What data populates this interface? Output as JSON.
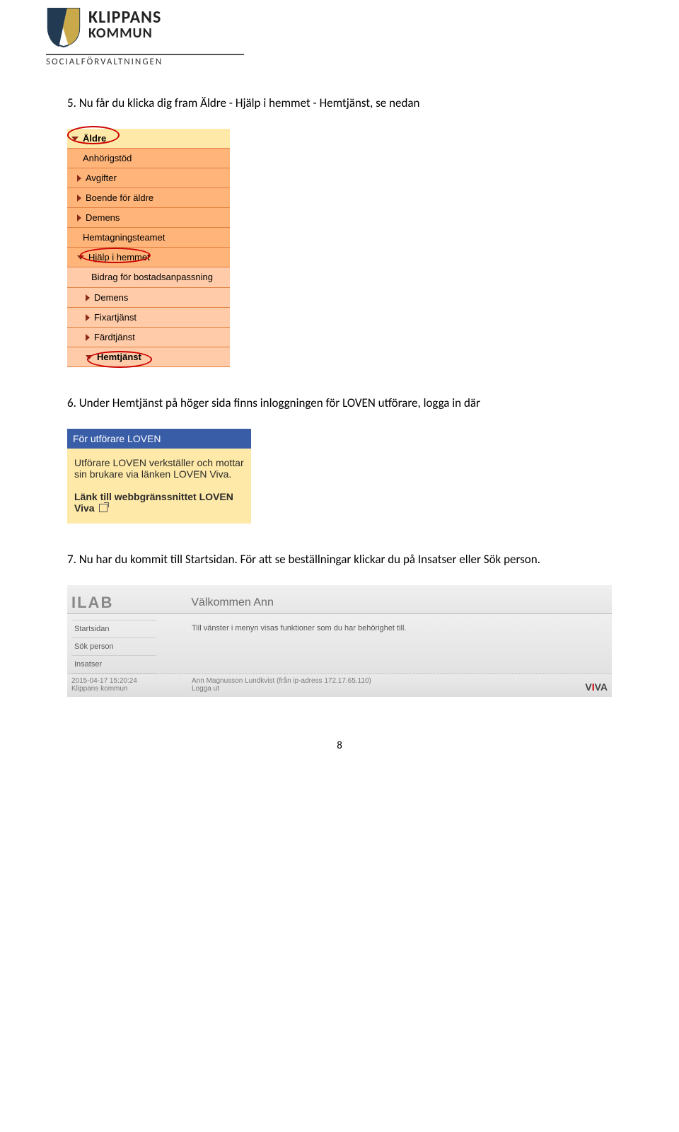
{
  "logo": {
    "line1": "KLIPPANS",
    "line2": "KOMMUN",
    "sub": "SOCIALFÖRVALTNINGEN"
  },
  "steps": {
    "s5": "5. Nu får du klicka dig fram Äldre - Hjälp i hemmet - Hemtjänst, se nedan",
    "s6": "6. Under Hemtjänst på höger sida finns inloggningen för LOVEN utförare, logga in där",
    "s7": "7. Nu har du kommit till Startsidan. För att se beställningar klickar du på Insatser eller Sök person."
  },
  "nav": {
    "aldre": "Äldre",
    "items1": [
      "Anhörigstöd",
      "Avgifter",
      "Boende för äldre",
      "Demens",
      "Hemtagningsteamet"
    ],
    "hjalp": "Hjälp i hemmet",
    "items2_first": "Bidrag för bostadsanpassning",
    "items2": [
      "Demens",
      "Fixartjänst",
      "Färdtjänst"
    ],
    "hemtjanst": "Hemtjänst"
  },
  "loven": {
    "title": "För utförare LOVEN",
    "body": "Utförare LOVEN verkställer och mottar sin brukare via länken LOVEN Viva.",
    "linktitle": "Länk till webbgränssnittet LOVEN Viva"
  },
  "app": {
    "brand": "ILAB",
    "welcome": "Välkommen Ann",
    "subtext": "Till vänster i menyn visas funktioner som du har behörighet till.",
    "menu": [
      "Startsidan",
      "Sök person",
      "Insatser"
    ],
    "footer": {
      "ts": "2015-04-17 15:20:24",
      "org": "Klippans kommun",
      "user": "Ann Magnusson Lundkvist (från ip-adress 172.17.65.110)",
      "logout": "Logga ut",
      "viva": "VIVA"
    }
  },
  "pagenum": "8"
}
